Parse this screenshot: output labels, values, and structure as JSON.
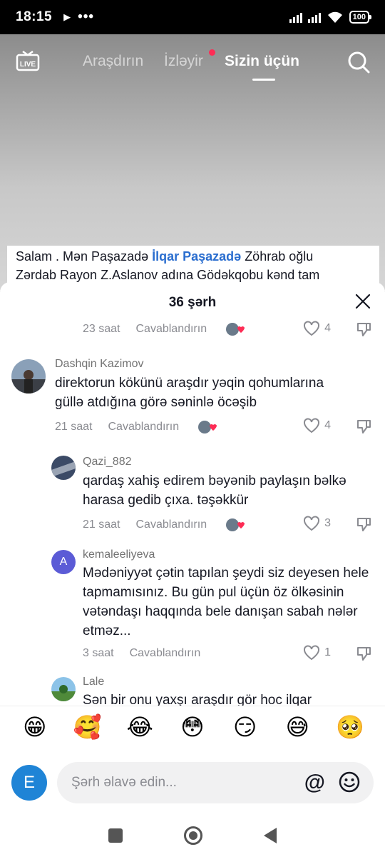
{
  "status": {
    "time": "18:15",
    "play_glyph": "▶",
    "dots": "•••",
    "battery": "100"
  },
  "nav": {
    "tabs": [
      {
        "label": "Araşdırın",
        "active": false
      },
      {
        "label": "İzləyir",
        "active": false,
        "dot": true
      },
      {
        "label": "Sizin üçün",
        "active": true
      }
    ],
    "live_label": "LIVE"
  },
  "caption": {
    "line1_pre": "Salam . Mən Paşazadə ",
    "mention": "İlqar Paşazadə",
    "line1_post": " Zöhrab oğlu",
    "line2": "Zərdab Rayon Z.Aslanov adına Gödəkqobu kənd tam"
  },
  "sheet": {
    "title": "36 şərh"
  },
  "partial_top": {
    "time": "23 saat",
    "reply": "Cavablandırın",
    "likes": "4"
  },
  "comments": [
    {
      "name": "Dashqin  Kazimov",
      "text": "direktorun kökünü araşdır yəqin qohumlarına güllə atdığına görə səninlə öcəşib",
      "time": "21 saat",
      "reply": "Cavablandırın",
      "likes": "4"
    },
    {
      "name": "Qazi_882",
      "text": "qardaş xahiş edirem bəyənib paylaşın bəlkə harasa gedib çıxa. təşəkkür",
      "time": "21 saat",
      "reply": "Cavablandırın",
      "likes": "3"
    },
    {
      "name": "kemaleeliyeva",
      "avatar_letter": "A",
      "text": "Mədəniyyət çətin tapılan şeydi siz deyesen hele tapmamısınız. Bu gün pul üçün öz ölkəsinin vətəndaşı haqqında bele danışan sabah nələr etməz...",
      "time": "3 saat",
      "reply": "Cavablandırın",
      "likes": "1"
    },
    {
      "name": "Lale",
      "text": "Sən bir onu yaxşı araşdır gör hoc ilqar"
    }
  ],
  "emojis": [
    "😁",
    "🥰",
    "😂",
    "😳",
    "😏",
    "😅",
    "🥺"
  ],
  "input": {
    "placeholder": "Şərh əlavə edin...",
    "at": "@",
    "user_letter": "E"
  },
  "colors": {
    "accent_red": "#fe2c55",
    "mention_blue": "#2b6ecf",
    "user_avatar": "#1f84d6",
    "letter_avatar": "#5b5bd6"
  }
}
